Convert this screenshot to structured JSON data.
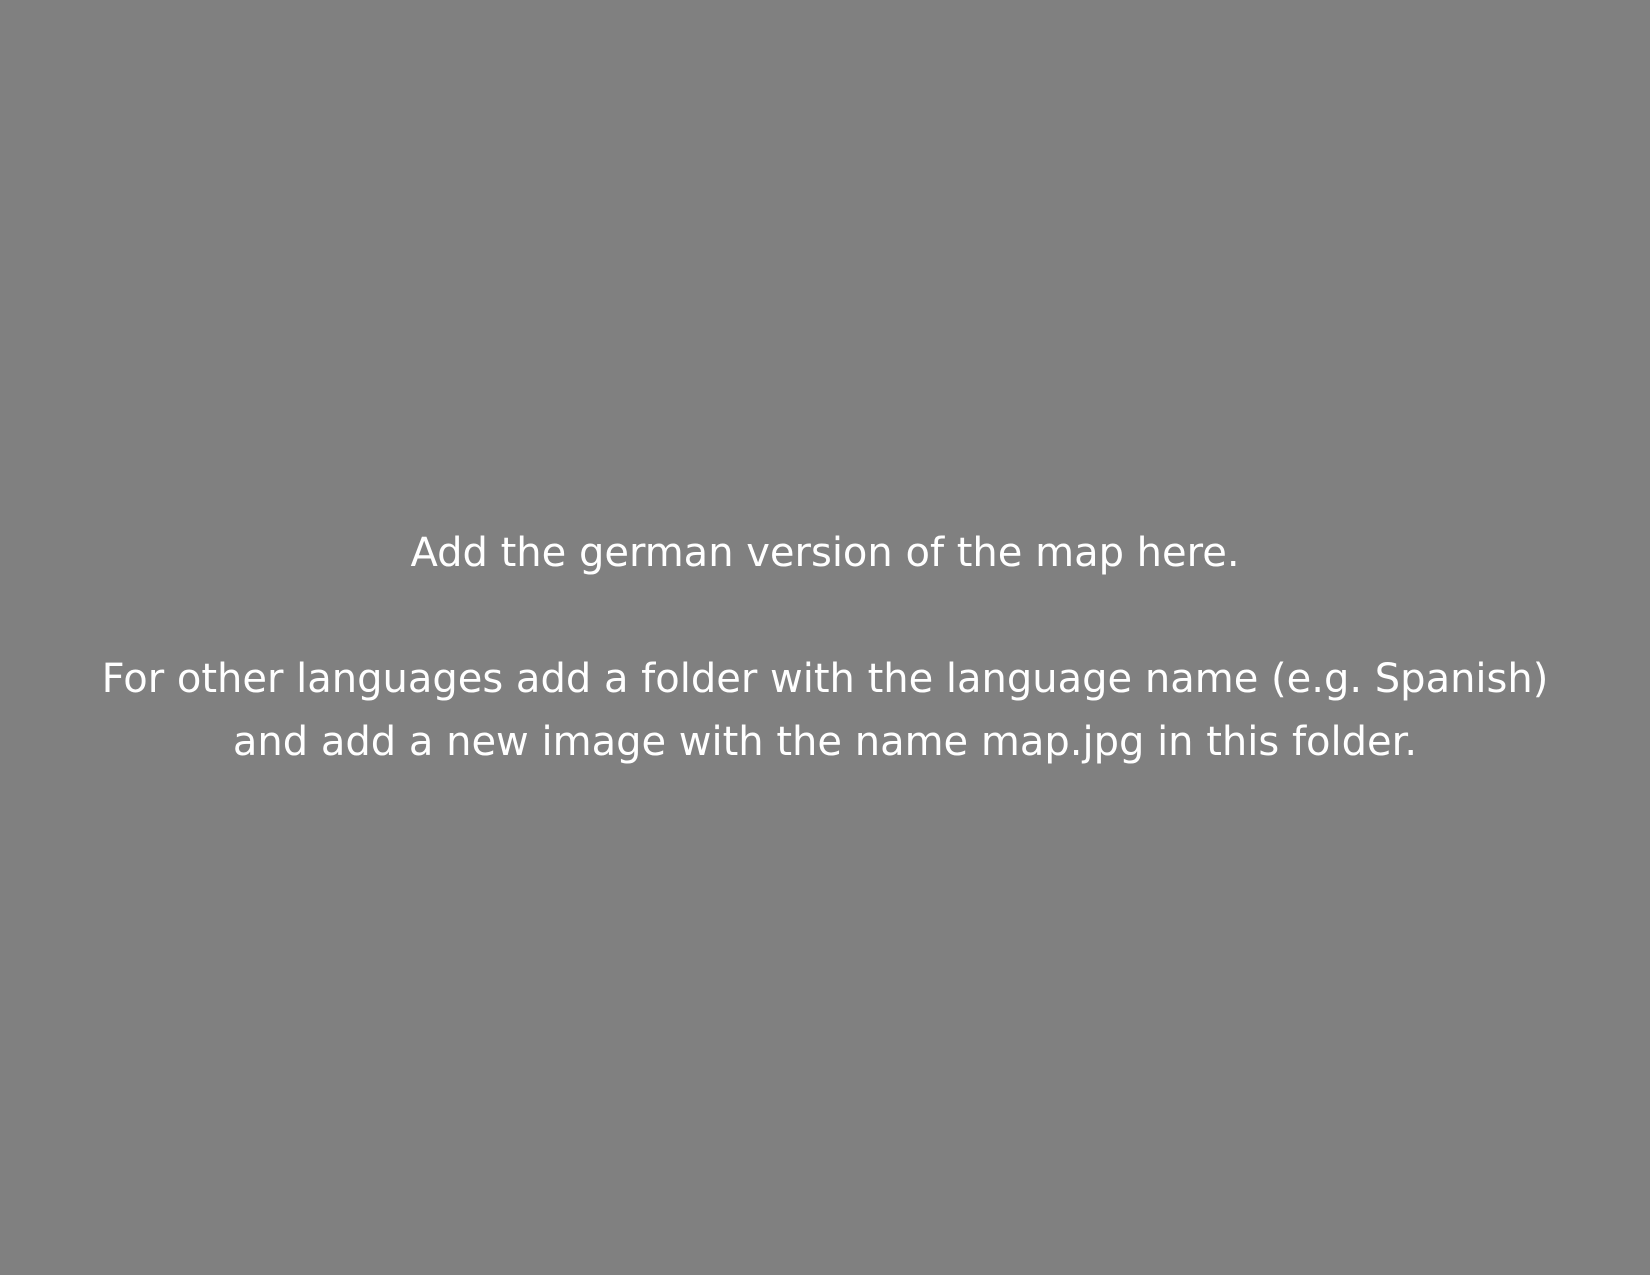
{
  "placeholder": {
    "line_1": "Add the german version of the map here.",
    "line_2": "For other languages add a folder with the language name (e.g. Spanish)",
    "line_3": "and add a new image with the name map.jpg in this folder."
  },
  "colors": {
    "background": "#808080",
    "text": "#ffffff"
  }
}
